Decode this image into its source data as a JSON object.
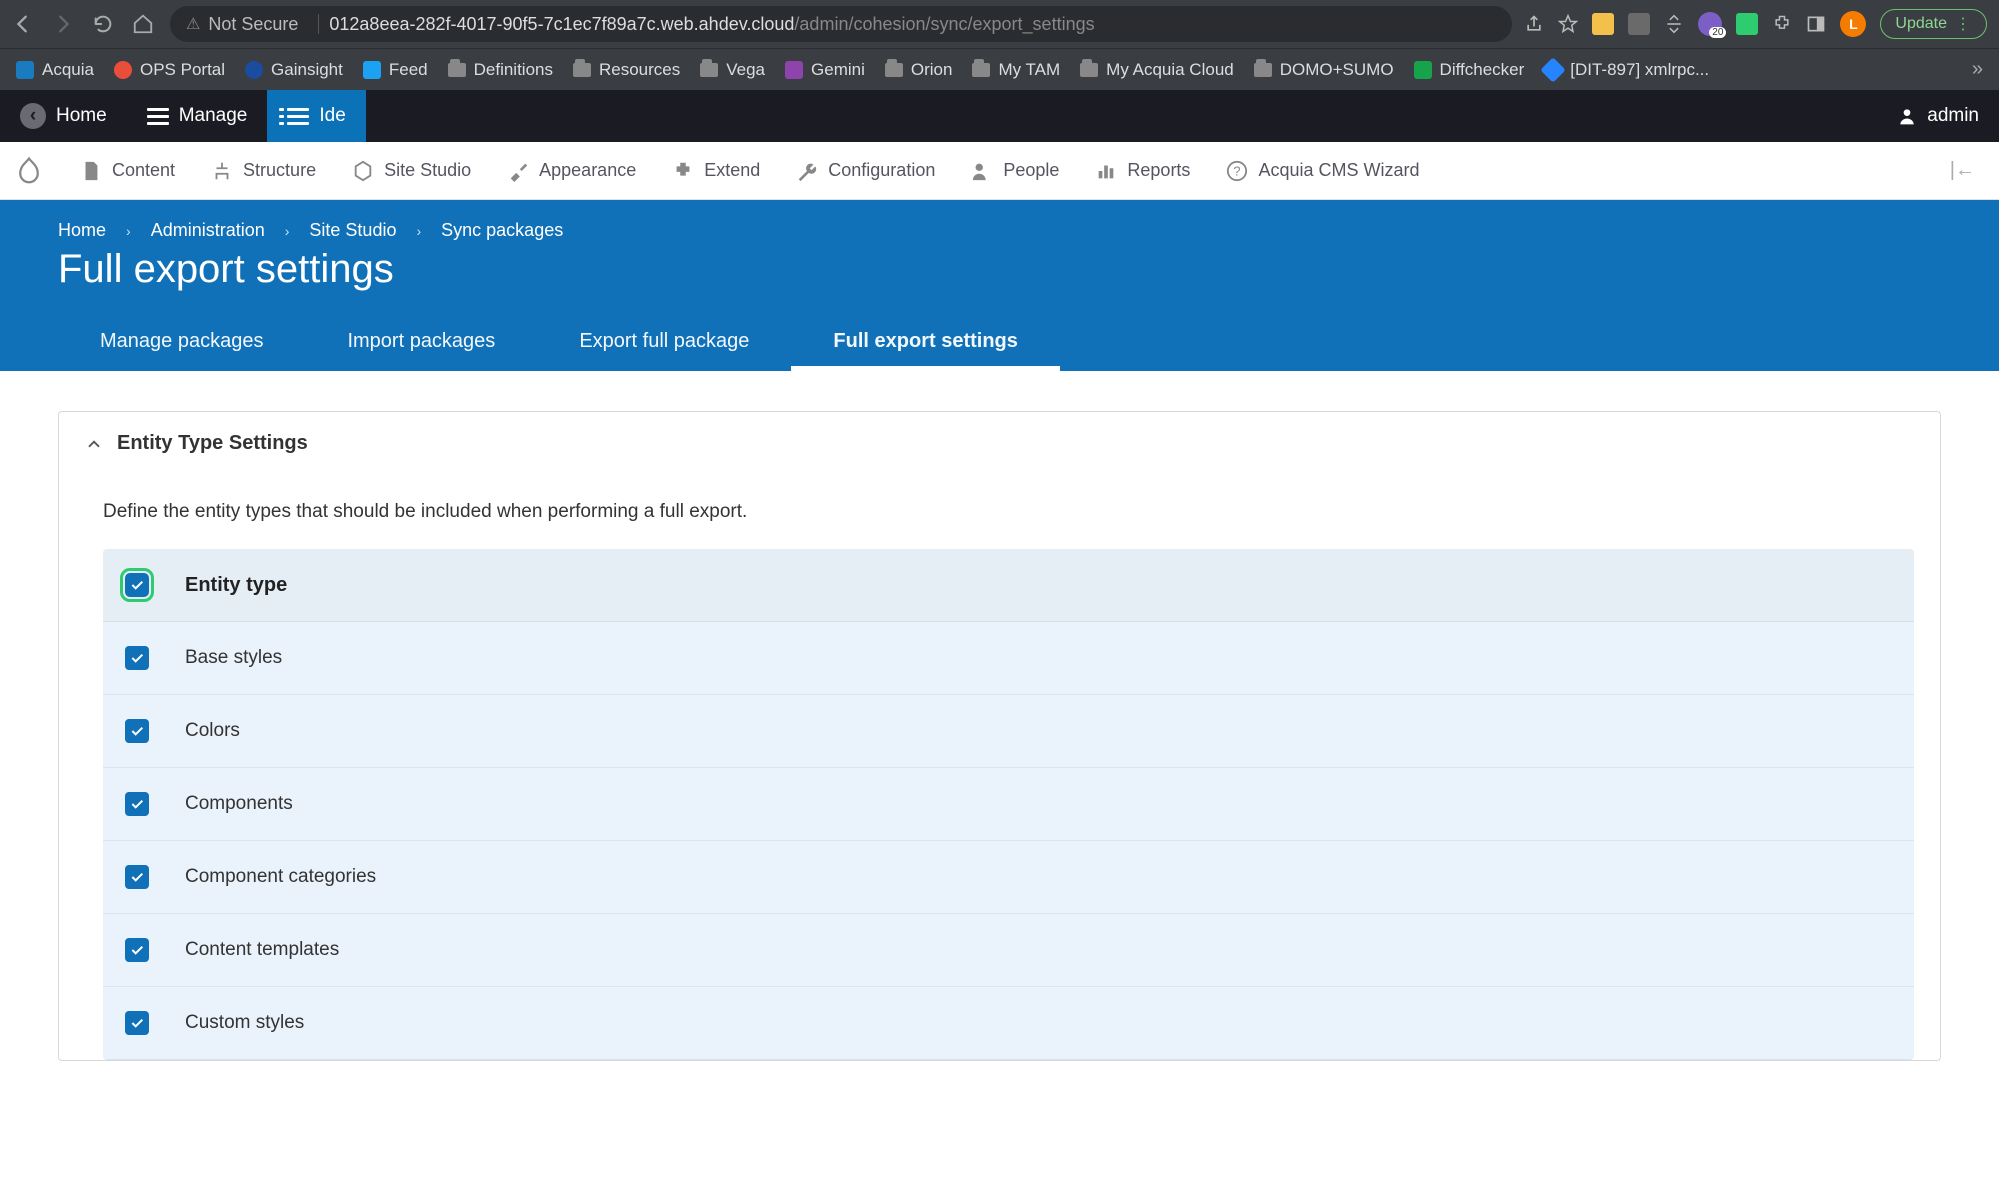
{
  "browser": {
    "not_secure": "Not Secure",
    "url_host": "012a8eea-282f-4017-90f5-7c1ec7f89a7c.web.ahdev.cloud",
    "url_path": "/admin/cohesion/sync/export_settings",
    "update_label": "Update",
    "avatar_letter": "L"
  },
  "bookmarks": [
    {
      "label": "Acquia"
    },
    {
      "label": "OPS Portal"
    },
    {
      "label": "Gainsight"
    },
    {
      "label": "Feed"
    },
    {
      "label": "Definitions"
    },
    {
      "label": "Resources"
    },
    {
      "label": "Vega"
    },
    {
      "label": "Gemini"
    },
    {
      "label": "Orion"
    },
    {
      "label": "My TAM"
    },
    {
      "label": "My Acquia Cloud"
    },
    {
      "label": "DOMO+SUMO"
    },
    {
      "label": "Diffchecker"
    },
    {
      "label": "[DIT-897] xmlrpc..."
    }
  ],
  "toolbar": {
    "home": "Home",
    "manage": "Manage",
    "ide": "Ide",
    "admin_user": "admin"
  },
  "admin_menu": [
    "Content",
    "Structure",
    "Site Studio",
    "Appearance",
    "Extend",
    "Configuration",
    "People",
    "Reports",
    "Acquia CMS Wizard"
  ],
  "breadcrumb": [
    "Home",
    "Administration",
    "Site Studio",
    "Sync packages"
  ],
  "page_title": "Full export settings",
  "tabs": [
    {
      "label": "Manage packages",
      "active": false
    },
    {
      "label": "Import packages",
      "active": false
    },
    {
      "label": "Export full package",
      "active": false
    },
    {
      "label": "Full export settings",
      "active": true
    }
  ],
  "panel": {
    "title": "Entity Type Settings",
    "description": "Define the entity types that should be included when performing a full export.",
    "header_label": "Entity type",
    "rows": [
      "Base styles",
      "Colors",
      "Components",
      "Component categories",
      "Content templates",
      "Custom styles"
    ]
  }
}
